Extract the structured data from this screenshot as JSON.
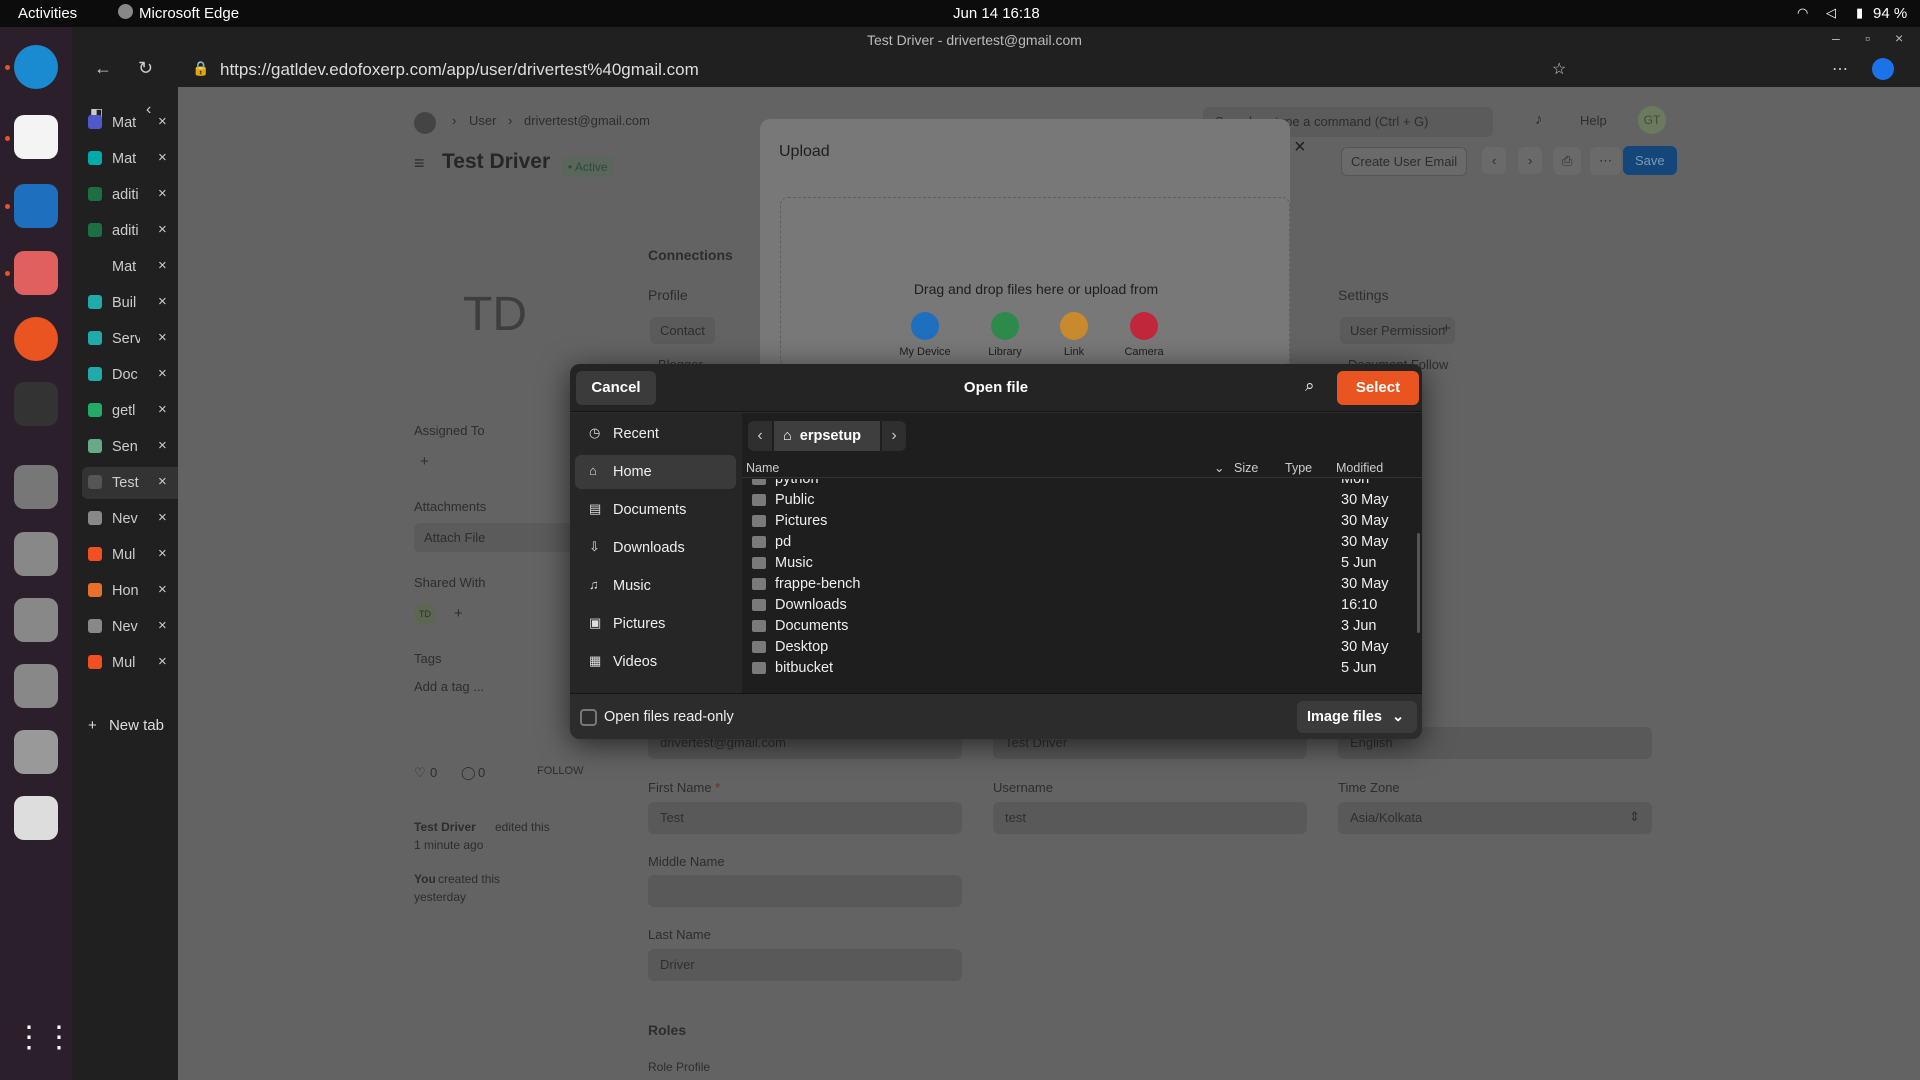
{
  "topbar": {
    "activities": "Activities",
    "app": "Microsoft Edge",
    "clock": "Jun 14  16:18",
    "battery": "94 %"
  },
  "browser": {
    "title": "Test Driver - drivertest@gmail.com",
    "url": "https://gatldev.edofoxerp.com/app/user/drivertest%40gmail.com"
  },
  "tabs": [
    {
      "label": "Mat",
      "color": "#5059c9"
    },
    {
      "label": "Mat",
      "color": "#0aa"
    },
    {
      "label": "aditi",
      "color": "#1d6f42"
    },
    {
      "label": "aditi",
      "color": "#1d6f42"
    },
    {
      "label": "Mat",
      "color": "#202020"
    },
    {
      "label": "Buil",
      "color": "#2aa"
    },
    {
      "label": "Serv",
      "color": "#2aa"
    },
    {
      "label": "Doc",
      "color": "#2aa"
    },
    {
      "label": "getl",
      "color": "#2a6"
    },
    {
      "label": "Sen",
      "color": "#6a8"
    },
    {
      "label": "Test",
      "color": "#555"
    },
    {
      "label": "Nev",
      "color": "#888"
    },
    {
      "label": "Mul",
      "color": "#f25022"
    },
    {
      "label": "Hon",
      "color": "#e8702a"
    },
    {
      "label": "Nev",
      "color": "#888"
    },
    {
      "label": "Mul",
      "color": "#f25022"
    }
  ],
  "new_tab": "New tab",
  "erp": {
    "breadcrumb": [
      "User",
      "drivertest@gmail.com"
    ],
    "search_placeholder": "Search or type a command (Ctrl + G)",
    "help": "Help",
    "avatar": "GT",
    "title": "Test Driver",
    "status": "• Active",
    "create_email": "Create User Email",
    "save": "Save",
    "initials": "TD",
    "connections": "Connections",
    "profile": "Profile",
    "contact": "Contact",
    "blogger": "Blogger",
    "settings": "Settings",
    "user_permission": "User Permission",
    "document_follow": "Document Follow",
    "assigned_to": "Assigned To",
    "attachments": "Attachments",
    "attach_file": "Attach File",
    "shared_with": "Shared With",
    "shared_avatar": "TD",
    "tags": "Tags",
    "add_tag": "Add a tag ...",
    "likes": "0",
    "comments": "0",
    "follow": "FOLLOW",
    "activity1_user": "Test Driver",
    "activity1_text": " edited this",
    "activity1_time": "1 minute ago",
    "activity2_user": "You",
    "activity2_text": " created this",
    "activity2_time": "yesterday",
    "email_value": "drivertest@gmail.com",
    "full_name_value": "Test Driver",
    "language_value": "English",
    "first_name_label": "First Name",
    "first_name_value": "Test",
    "username_label": "Username",
    "username_value": "test",
    "timezone_label": "Time Zone",
    "timezone_value": "Asia/Kolkata",
    "middle_name_label": "Middle Name",
    "last_name_label": "Last Name",
    "last_name_value": "Driver",
    "roles": "Roles",
    "role_profile": "Role Profile"
  },
  "upload": {
    "title": "Upload",
    "drop_text": "Drag and drop files here or upload from",
    "sources": [
      {
        "label": "My Device",
        "color": "#1f6fbf"
      },
      {
        "label": "Library",
        "color": "#2e8a4a"
      },
      {
        "label": "Link",
        "color": "#c98a2e"
      },
      {
        "label": "Camera",
        "color": "#c2263b"
      }
    ]
  },
  "dialog": {
    "cancel": "Cancel",
    "title": "Open file",
    "select": "Select",
    "path": "erpsetup",
    "sidebar": [
      {
        "label": "Recent",
        "icon": "clock-icon",
        "glyph": "◷"
      },
      {
        "label": "Home",
        "icon": "home-icon",
        "glyph": "⌂"
      },
      {
        "label": "Documents",
        "icon": "document-icon",
        "glyph": "▤"
      },
      {
        "label": "Downloads",
        "icon": "download-icon",
        "glyph": "⇩"
      },
      {
        "label": "Music",
        "icon": "music-icon",
        "glyph": "♫"
      },
      {
        "label": "Pictures",
        "icon": "pictures-icon",
        "glyph": "▣"
      },
      {
        "label": "Videos",
        "icon": "videos-icon",
        "glyph": "▦"
      }
    ],
    "columns": {
      "name": "Name",
      "size": "Size",
      "type": "Type",
      "modified": "Modified"
    },
    "files": [
      {
        "name": "python",
        "modified": "Mon"
      },
      {
        "name": "Public",
        "modified": "30 May"
      },
      {
        "name": "Pictures",
        "modified": "30 May"
      },
      {
        "name": "pd",
        "modified": "30 May"
      },
      {
        "name": "Music",
        "modified": "5 Jun"
      },
      {
        "name": "frappe-bench",
        "modified": "30 May"
      },
      {
        "name": "Downloads",
        "modified": "16:10"
      },
      {
        "name": "Documents",
        "modified": "3 Jun"
      },
      {
        "name": "Desktop",
        "modified": "30 May"
      },
      {
        "name": "bitbucket",
        "modified": "5 Jun"
      }
    ],
    "read_only": "Open files read-only",
    "filter": "Image files"
  },
  "colors": {
    "accent": "#e95420",
    "erp_blue": "#2490ef"
  }
}
